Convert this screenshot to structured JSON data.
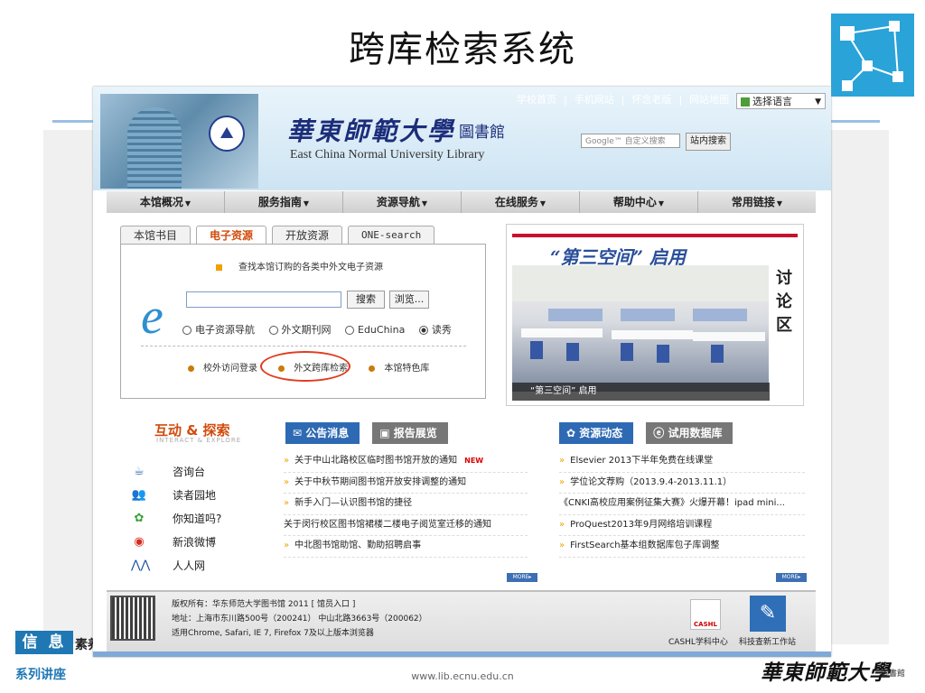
{
  "slide": {
    "title": "跨库检索系统",
    "badge": "信 息",
    "badge_tail": "素养",
    "series": "系列讲座",
    "url": "www.lib.ecnu.edu.cn",
    "sign_cn": "華東師範大學",
    "sign_lib": "圖書館"
  },
  "site": {
    "header": {
      "university_cn": "華東師範大學",
      "library_cn": "圖書館",
      "university_en": "East China Normal University Library",
      "top_links": [
        "学校首页",
        "|",
        "手机网站",
        "|",
        "怀念老版",
        "|",
        "网站地图",
        "|"
      ],
      "language": "选择语言",
      "google_placeholder": "Google™ 自定义搜索",
      "site_search_label": "站内搜索"
    },
    "nav": [
      "本馆概况",
      "服务指南",
      "资源导航",
      "在线服务",
      "帮助中心",
      "常用链接"
    ],
    "tabs": [
      "本馆书目",
      "电子资源",
      "开放资源",
      "ONE-search"
    ],
    "search": {
      "hint": "查找本馆订购的各类中外文电子资源",
      "search_button": "搜索",
      "browse_button": "浏览...",
      "radios": [
        "电子资源导航",
        "外文期刊网",
        "EduChina",
        "读秀"
      ],
      "quick_links": [
        "校外访问登录",
        "外文跨库检索",
        "本馆特色库"
      ]
    },
    "promo": {
      "title": "“第三空间” 启用",
      "side_text": [
        "讨",
        "论",
        "区"
      ],
      "caption": "“第三空间” 启用"
    },
    "interact": {
      "title": "互动 & 探索",
      "subtitle": "INTERACT & EXPLORE",
      "items": [
        {
          "icon": "cup-icon",
          "label": "咨询台"
        },
        {
          "icon": "people-icon",
          "label": "读者园地"
        },
        {
          "icon": "question-icon",
          "label": "你知道吗?"
        },
        {
          "icon": "weibo-icon",
          "label": "新浪微博"
        },
        {
          "icon": "renren-icon",
          "label": "人人网"
        }
      ]
    },
    "news": {
      "tab_notice": "公告消息",
      "tab_report": "报告展览",
      "items": [
        "关于中山北路校区临时图书馆开放的通知",
        "关于中秋节期间图书馆开放安排调整的通知",
        "新手入门—认识图书馆的捷径",
        "关于闵行校区图书馆裙楼二楼电子阅览室迁移的通知",
        "中北图书馆助馆、勤助招聘启事"
      ],
      "new_badge": "NEW",
      "more": "MORE▸"
    },
    "resources": {
      "tab_news": "资源动态",
      "tab_trial": "试用数据库",
      "items": [
        "Elsevier 2013下半年免费在线课堂",
        "学位论文荐购（2013.9.4-2013.11.1）",
        "《CNKI高校应用案例征集大赛》火爆开幕！ipad mini...",
        "ProQuest2013年9月网络培训课程",
        "FirstSearch基本组数据库包子库调整"
      ],
      "more": "MORE▸"
    },
    "footer": {
      "copyright": "版权所有：华东师范大学图书馆  2011 [ 馆员入口 ]",
      "address": "地址：上海市东川路500号（200241） 中山北路3663号（200062）",
      "browsers": "适用Chrome, Safari, IE 7, Firefox 7及以上版本浏览器",
      "cashl_label": "CASHL学科中心",
      "sci_label": "科技查新工作站",
      "cashl_icon_text": "CASHL"
    }
  }
}
